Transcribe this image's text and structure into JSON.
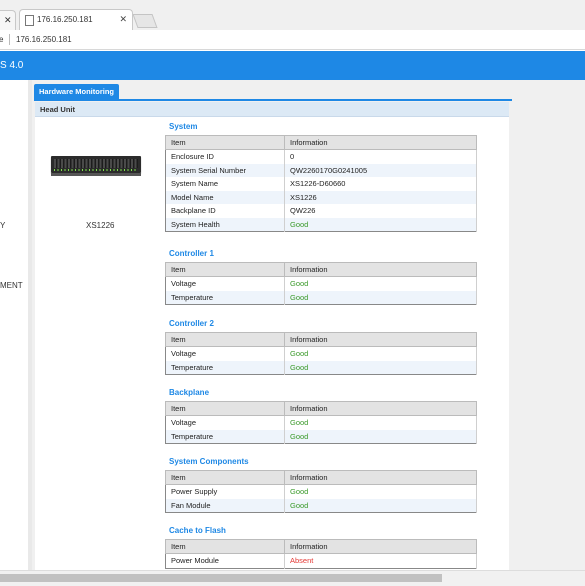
{
  "browser": {
    "active_tab_title": "176.16.250.181",
    "address_prefix": "e",
    "url": "176.16.250.181"
  },
  "app": {
    "brand": "S 4.0",
    "accent_color": "#1e88e5"
  },
  "sidenav": {
    "items": [
      "Y",
      "MENT"
    ]
  },
  "main": {
    "tab_label": "Hardware Monitoring",
    "panel_title": "Head Unit",
    "device_name": "XS1226"
  },
  "sections": [
    {
      "title": "System",
      "headers": [
        "Item",
        "Information"
      ],
      "rows": [
        [
          "Enclosure ID",
          "0"
        ],
        [
          "System Serial Number",
          "QW2260170G0241005"
        ],
        [
          "System Name",
          "XS1226-D60660"
        ],
        [
          "Model Name",
          "XS1226"
        ],
        [
          "Backplane ID",
          "QW226"
        ],
        [
          "System Health",
          "Good"
        ]
      ]
    },
    {
      "title": "Controller 1",
      "headers": [
        "Item",
        "Information"
      ],
      "rows": [
        [
          "Voltage",
          "Good"
        ],
        [
          "Temperature",
          "Good"
        ]
      ]
    },
    {
      "title": "Controller 2",
      "headers": [
        "Item",
        "Information"
      ],
      "rows": [
        [
          "Voltage",
          "Good"
        ],
        [
          "Temperature",
          "Good"
        ]
      ]
    },
    {
      "title": "Backplane",
      "headers": [
        "Item",
        "Information"
      ],
      "rows": [
        [
          "Voltage",
          "Good"
        ],
        [
          "Temperature",
          "Good"
        ]
      ]
    },
    {
      "title": "System Components",
      "headers": [
        "Item",
        "Information"
      ],
      "rows": [
        [
          "Power Supply",
          "Good"
        ],
        [
          "Fan Module",
          "Good"
        ]
      ]
    },
    {
      "title": "Cache to Flash",
      "headers": [
        "Item",
        "Information"
      ],
      "rows": [
        [
          "Power Module",
          "Absent"
        ]
      ]
    }
  ],
  "status_colors": {
    "Good": "#3a9a2a",
    "Absent": "#e53935"
  }
}
